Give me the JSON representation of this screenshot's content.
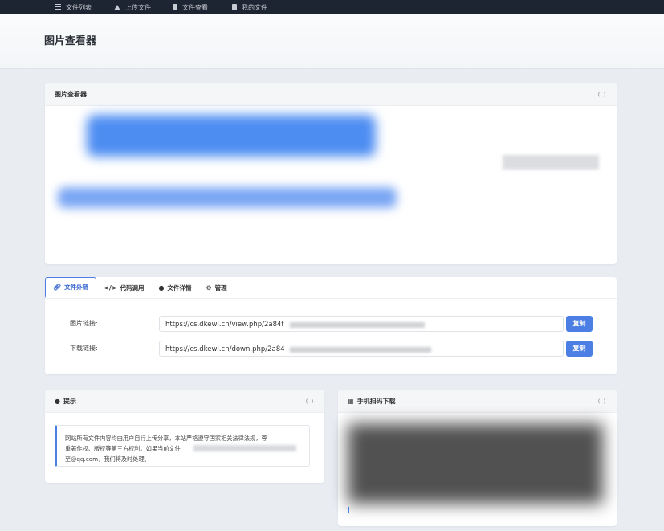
{
  "nav": {
    "items": [
      {
        "label": "文件列表",
        "icon": "list-icon"
      },
      {
        "label": "上传文件",
        "icon": "upload-icon"
      },
      {
        "label": "文件查看",
        "icon": "file-icon"
      },
      {
        "label": "我的文件",
        "icon": "file-icon"
      }
    ]
  },
  "page": {
    "title": "图片查看器"
  },
  "viewer": {
    "title": "图片查看器"
  },
  "tabs": [
    {
      "label": "文件外链",
      "icon": "link-icon"
    },
    {
      "label": "代码调用",
      "icon": "code-icon"
    },
    {
      "label": "文件详情",
      "icon": "info-icon"
    },
    {
      "label": "管理",
      "icon": "gear-icon"
    }
  ],
  "links": {
    "image_label": "图片链接:",
    "image_value": "https://cs.dkewl.cn/view.php/2a84f",
    "download_label": "下载链接:",
    "download_value": "https://cs.dkewl.cn/down.php/2a84",
    "copy_label": "复制"
  },
  "notice": {
    "title": "提示",
    "line1": "网站所有文件内容均由用户自行上传分享，本站严格遵守国家相关法律法规，尊",
    "line2": "重著作权、版权等第三方权利。如果当前文件",
    "line3": "至@qq.com，我们将及时处理。"
  },
  "qr": {
    "title": "手机扫码下载"
  },
  "colors": {
    "accent": "#4c7fe3",
    "nav_bg": "#1e2532"
  }
}
